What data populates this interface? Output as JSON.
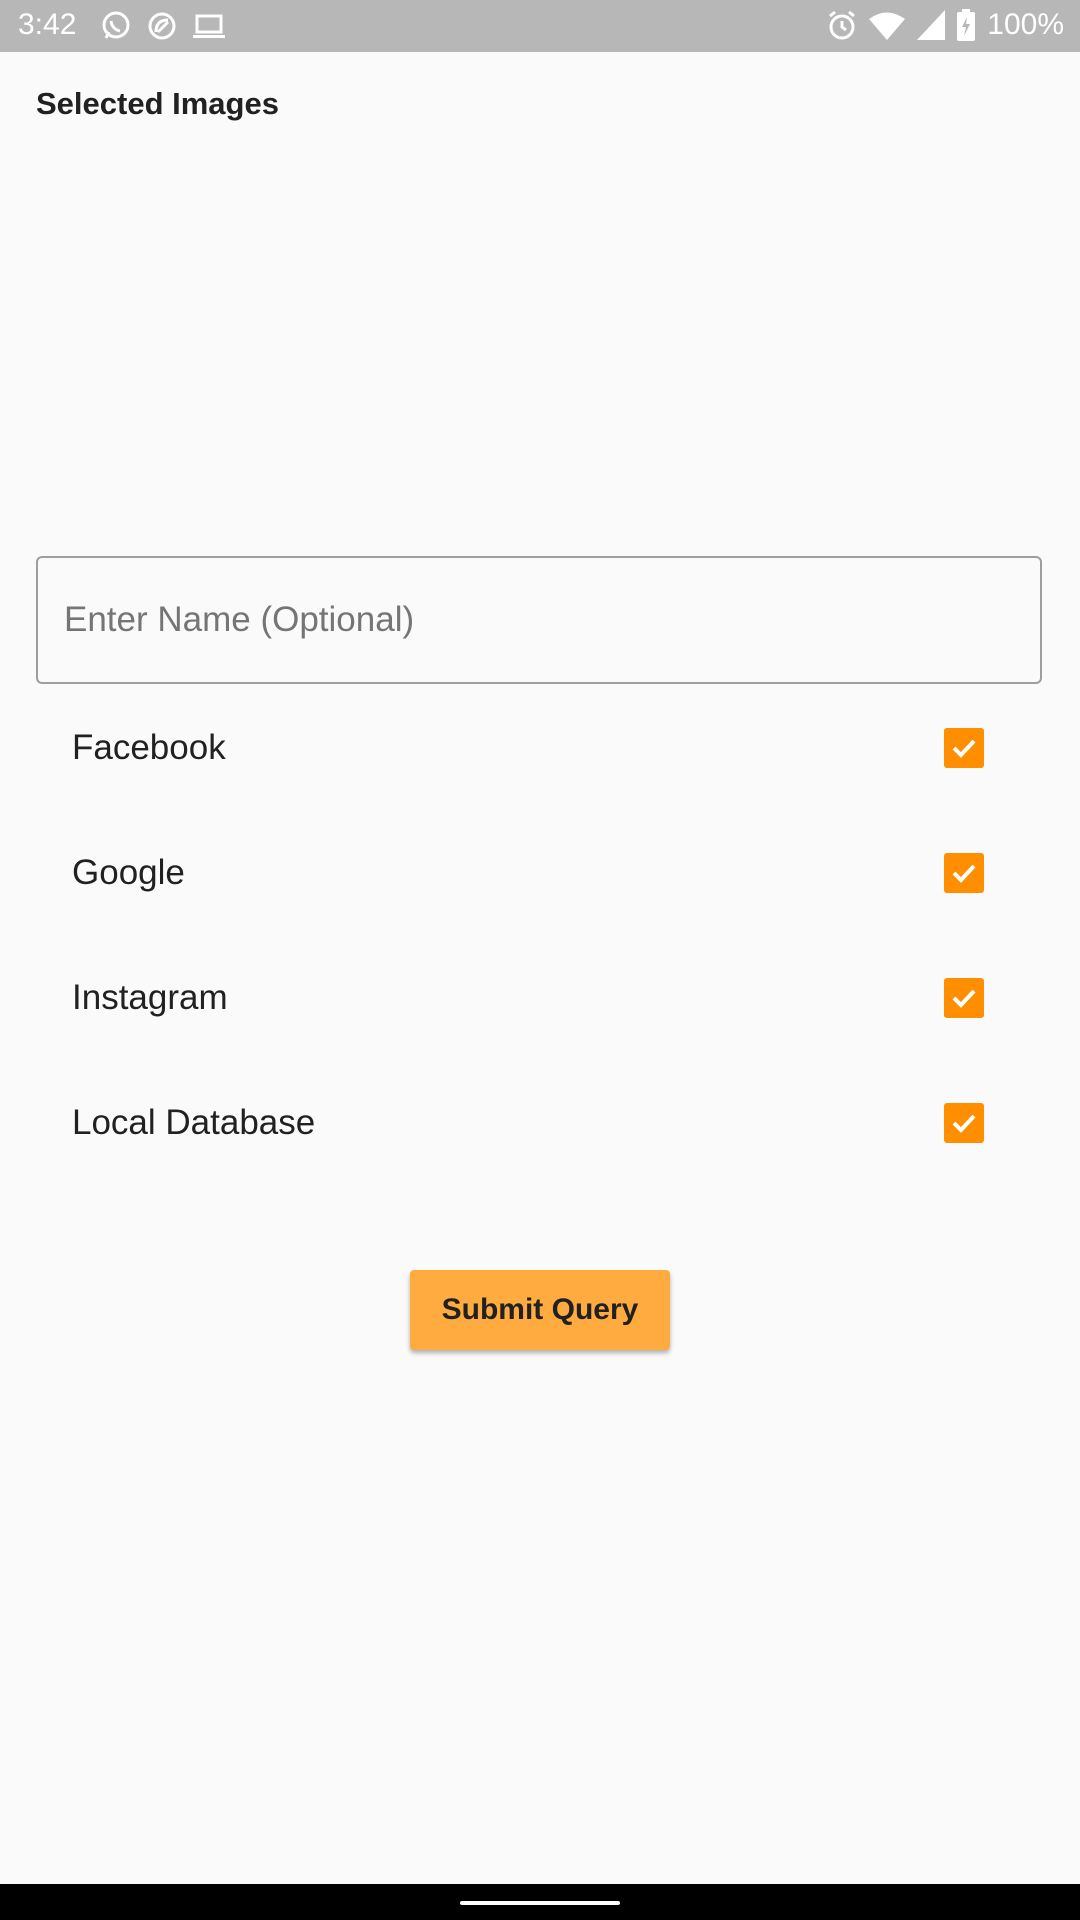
{
  "status_bar": {
    "time": "3:42",
    "battery": "100%",
    "left_icons": [
      "whatsapp-icon",
      "sync-icon",
      "laptop-icon"
    ],
    "right_icons": [
      "alarm-icon",
      "wifi-icon",
      "signal-icon",
      "battery-charging-icon"
    ]
  },
  "heading": "Selected Images",
  "name_input": {
    "placeholder": "Enter Name (Optional)",
    "value": ""
  },
  "options": [
    {
      "label": "Facebook",
      "checked": true
    },
    {
      "label": "Google",
      "checked": true
    },
    {
      "label": "Instagram",
      "checked": true
    },
    {
      "label": "Local Database",
      "checked": true
    }
  ],
  "submit_label": "Submit Query",
  "colors": {
    "accent": "#ff8f00",
    "button": "#ffab40",
    "background": "#fafafa",
    "status_bar": "#b7b7b7"
  }
}
